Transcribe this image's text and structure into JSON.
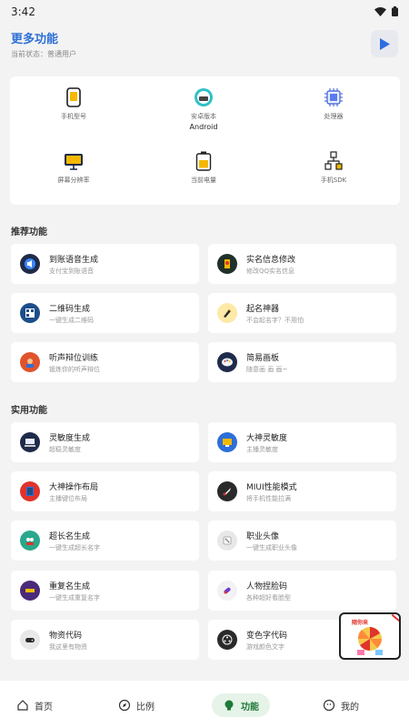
{
  "status": {
    "time": "3:42"
  },
  "header": {
    "title": "更多功能",
    "subtitle": "当前状态：普通用户"
  },
  "device": {
    "items": [
      {
        "label": "手机型号",
        "value": ""
      },
      {
        "label": "安卓版本",
        "value": "Android"
      },
      {
        "label": "处理器",
        "value": ""
      },
      {
        "label": "屏幕分辨率",
        "value": ""
      },
      {
        "label": "当前电量",
        "value": ""
      },
      {
        "label": "手机SDK",
        "value": ""
      }
    ]
  },
  "recommended": {
    "title": "推荐功能",
    "items": [
      {
        "title": "到账语音生成",
        "desc": "支付宝到账语音"
      },
      {
        "title": "实名信息修改",
        "desc": "修改QQ实名信息"
      },
      {
        "title": "二维码生成",
        "desc": "一键生成二维码"
      },
      {
        "title": "起名神器",
        "desc": "不会起名字？不用怕"
      },
      {
        "title": "听声辩位训练",
        "desc": "锻炼你的听声辩位"
      },
      {
        "title": "简易画板",
        "desc": "随意画 画 画~"
      }
    ]
  },
  "practical": {
    "title": "实用功能",
    "items": [
      {
        "title": "灵敏度生成",
        "desc": "超稳灵敏度"
      },
      {
        "title": "大神灵敏度",
        "desc": "主播灵敏度"
      },
      {
        "title": "大神操作布局",
        "desc": "主播键位布局"
      },
      {
        "title": "MIUI性能模式",
        "desc": "将手机性能拉满"
      },
      {
        "title": "超长名生成",
        "desc": "一键生成超长名字"
      },
      {
        "title": "职业头像",
        "desc": "一键生成职业头像"
      },
      {
        "title": "重复名生成",
        "desc": "一键生成重复名字"
      },
      {
        "title": "人物捏脸码",
        "desc": "各种超好看脸型"
      },
      {
        "title": "物资代码",
        "desc": "我这里有物资"
      },
      {
        "title": "变色字代码",
        "desc": "游戏颜色文字"
      }
    ]
  },
  "nav": {
    "items": [
      "首页",
      "比例",
      "功能",
      "我的"
    ]
  },
  "ad": {
    "title": "随你来"
  },
  "colors": {
    "accent": "#2d6fd8",
    "nav_active_bg": "#e6f3e8",
    "nav_active_fg": "#1d7a3a"
  }
}
